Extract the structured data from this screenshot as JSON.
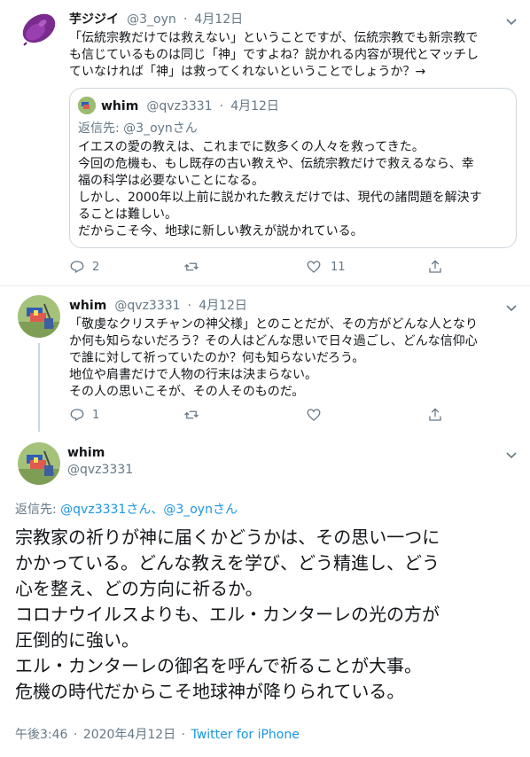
{
  "tweet1": {
    "display_name": "芋ジジイ",
    "handle": "@3_oyn",
    "separator": "·",
    "date": "4月12日",
    "text_lines": [
      "「伝統宗教だけでは救えない」ということですが、伝統宗教でも新宗教で",
      "も信じているものは同じ「神」ですよね？説かれる内容が現代とマッチし",
      "ていなければ「神」は救ってくれないということでしょうか？→"
    ],
    "quote": {
      "display_name": "whim",
      "handle": "@qvz3331",
      "separator": "·",
      "date": "4月12日",
      "reply_to": "返信先: @3_oynさん",
      "text_lines": [
        "イエスの愛の教えは、これまでに数多くの人々を救ってきた。",
        "今回の危機も、もし既存の古い教えや、伝統宗教だけで救えるなら、幸",
        "福の科学は必要ないことになる。",
        "しかし、2000年以上前に説かれた教えだけでは、現代の諸問題を解決す",
        "ることは難しい。",
        "だからこそ今、地球に新しい教えが説かれている。"
      ]
    },
    "replies": "2",
    "retweets": "",
    "likes": "11"
  },
  "tweet2": {
    "display_name": "whim",
    "handle": "@qvz3331",
    "separator": "·",
    "date": "4月12日",
    "text_lines": [
      "「敬虔なクリスチャンの神父様」とのことだが、その方がどんな人となり",
      "か何も知らないだろう？その人はどんな思いで日々過ごし、どんな信仰心",
      "で誰に対して祈っていたのか？何も知らないだろう。",
      "地位や肩書だけで人物の行末は決まらない。",
      "その人の思いこそが、その人そのものだ。"
    ],
    "replies": "1",
    "retweets": "",
    "likes": ""
  },
  "main_tweet": {
    "display_name": "whim",
    "handle": "@qvz3331",
    "reply_to_prefix": "返信先: ",
    "reply_to_users": "@qvz3331さん、@3_oynさん",
    "text_lines": [
      "宗教家の祈りが神に届くかどうかは、その思い一つに",
      "かかっている。どんな教えを学び、どう精進し、どう",
      "心を整え、どの方向に祈るか。",
      "コロナウイルスよりも、エル・カンターレの光の方が",
      "圧倒的に強い。",
      "エル・カンターレの御名を呼んで祈ることが大事。",
      "危機の時代だからこそ地球神が降りられている。"
    ],
    "time": "午後3:46",
    "dot": "·",
    "date": "2020年4月12日",
    "dot2": "·",
    "source": "Twitter for iPhone"
  },
  "colors": {
    "link": "#1b95e0",
    "muted": "#657786",
    "border": "#ccd6dd"
  },
  "icons": [
    "chevron-down-icon",
    "reply-icon",
    "retweet-icon",
    "like-icon",
    "share-icon"
  ]
}
